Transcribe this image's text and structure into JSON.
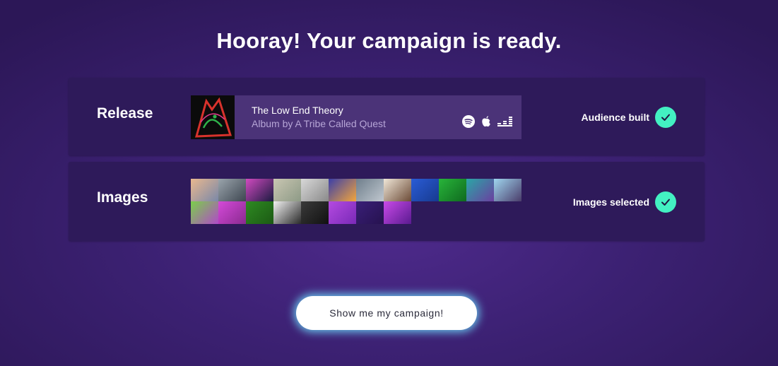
{
  "headline": "Hooray! Your campaign is ready.",
  "release": {
    "label": "Release",
    "album_title": "The Low End Theory",
    "album_subtitle": "Album by A Tribe Called Quest",
    "platforms": [
      "spotify-icon",
      "apple-icon",
      "deezer-icon"
    ],
    "status": "Audience built"
  },
  "images": {
    "label": "Images",
    "status": "Images selected",
    "thumbnails": [
      {
        "name": "sunset-city",
        "colors": [
          "#e9b88f",
          "#7a88a8"
        ]
      },
      {
        "name": "city-blocks",
        "colors": [
          "#9aa4ac",
          "#3d4650"
        ]
      },
      {
        "name": "palm-neon",
        "colors": [
          "#d14ac0",
          "#1a1a40"
        ]
      },
      {
        "name": "aerial-map",
        "colors": [
          "#c9c6b2",
          "#8d9a86"
        ]
      },
      {
        "name": "grey-buildings",
        "colors": [
          "#d8d8d8",
          "#8a8a8a"
        ]
      },
      {
        "name": "night-skyline",
        "colors": [
          "#3b3fa8",
          "#f2a53c"
        ]
      },
      {
        "name": "street-view",
        "colors": [
          "#6f7f8c",
          "#c0c7cf"
        ]
      },
      {
        "name": "interior-room",
        "colors": [
          "#f0e7d8",
          "#6b4a36"
        ]
      },
      {
        "name": "blue-texture",
        "colors": [
          "#2a5cd6",
          "#173a8f"
        ]
      },
      {
        "name": "green-leaf",
        "colors": [
          "#28b43a",
          "#0f6a1f"
        ]
      },
      {
        "name": "teal-figure",
        "colors": [
          "#2aa6a6",
          "#6b3fa0"
        ]
      },
      {
        "name": "dancer-hair",
        "colors": [
          "#9fd6ef",
          "#4a3c6a"
        ]
      },
      {
        "name": "portrait-green",
        "colors": [
          "#7ad04a",
          "#b04ac8"
        ]
      },
      {
        "name": "magenta-pattern",
        "colors": [
          "#d44ad8",
          "#8a2a90"
        ]
      },
      {
        "name": "green-field",
        "colors": [
          "#2e8a22",
          "#1c5a14"
        ]
      },
      {
        "name": "dark-smoke",
        "colors": [
          "#f2f2f2",
          "#2a2a2a"
        ]
      },
      {
        "name": "speaker-dark",
        "colors": [
          "#3a3a3a",
          "#111111"
        ]
      },
      {
        "name": "purple-grid",
        "colors": [
          "#b44ae0",
          "#7a2ab8"
        ]
      },
      {
        "name": "deep-purple",
        "colors": [
          "#3a1f78",
          "#26124f"
        ]
      },
      {
        "name": "violet-burst",
        "colors": [
          "#c94ae8",
          "#5a1a90"
        ]
      }
    ]
  },
  "cta": "Show me my campaign!",
  "colors": {
    "accent_check": "#43f0c2",
    "panel_bg": "#2e1a5a",
    "card_bg": "#4b3378",
    "button_glow": "#6ee1ff"
  }
}
